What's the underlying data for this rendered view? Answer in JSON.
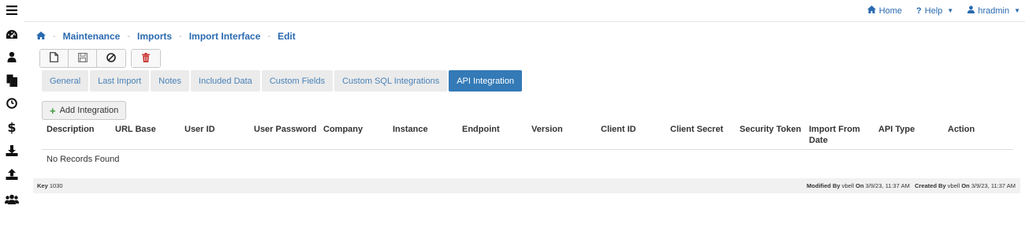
{
  "nav": {
    "home": "Home",
    "help": "Help",
    "user": "hradmin"
  },
  "breadcrumb": [
    "Maintenance",
    "Imports",
    "Import Interface",
    "Edit"
  ],
  "tabs": [
    "General",
    "Last Import",
    "Notes",
    "Included Data",
    "Custom Fields",
    "Custom SQL Integrations",
    "API Integration"
  ],
  "active_tab": "API Integration",
  "add_button": "Add Integration",
  "table": {
    "columns": [
      "Description",
      "URL Base",
      "User ID",
      "User Password",
      "Company",
      "Instance",
      "Endpoint",
      "Version",
      "Client ID",
      "Client Secret",
      "Security Token",
      "Import From Date",
      "API Type",
      "Action"
    ],
    "empty_message": "No Records Found"
  },
  "footer": {
    "key_label": "Key",
    "key_value": "1030",
    "modified_by_label": "Modified By",
    "modified_user": "vbell",
    "on_label": "On",
    "modified_on": "3/9/23, 11:37 AM",
    "created_by_label": "Created By",
    "created_user": "vbell",
    "created_on": "3/9/23, 11:37 AM"
  },
  "colors": {
    "link": "#2a6ab0",
    "active_tab": "#337ab7",
    "delete": "#c9302c",
    "add_plus": "#3a9a3a"
  },
  "icons": {
    "sidebar": [
      "dashboard-icon",
      "user-icon",
      "documents-icon",
      "clock-icon",
      "dollar-icon",
      "download-icon",
      "upload-icon",
      "group-icon"
    ],
    "toolbar": [
      "new-document-icon",
      "save-icon",
      "cancel-icon",
      "trash-icon"
    ]
  }
}
